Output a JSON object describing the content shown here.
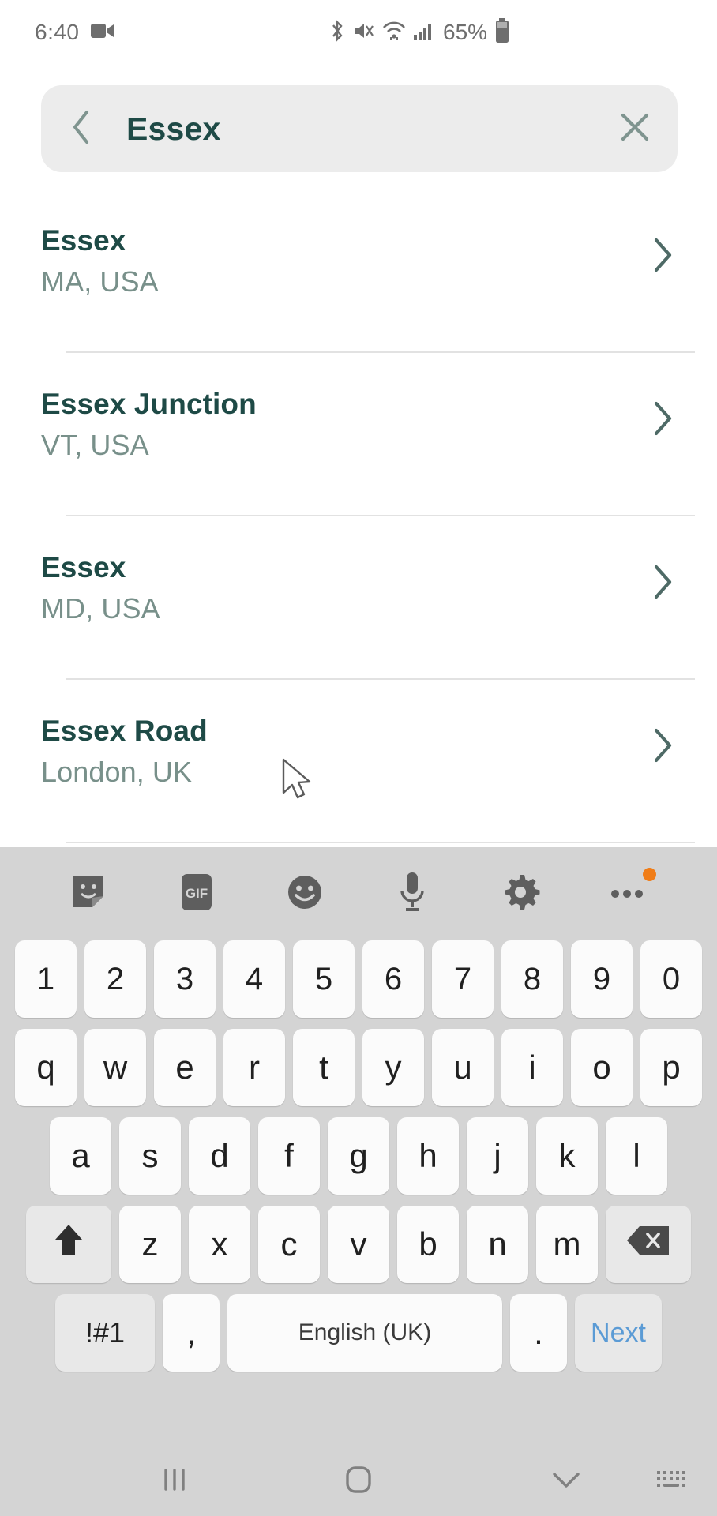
{
  "status_bar": {
    "time": "6:40",
    "battery_percent": "65%",
    "icons": [
      "video-recording-icon",
      "bluetooth-icon",
      "mute-vibrate-icon",
      "wifi-icon",
      "cellular-signal-icon",
      "battery-icon"
    ]
  },
  "search": {
    "query": "Essex",
    "back_icon": "chevron-left-icon",
    "clear_icon": "close-icon"
  },
  "results": [
    {
      "title": "Essex",
      "subtitle": "MA, USA"
    },
    {
      "title": "Essex Junction",
      "subtitle": "VT, USA"
    },
    {
      "title": "Essex",
      "subtitle": "MD, USA"
    },
    {
      "title": "Essex Road",
      "subtitle": "London, UK"
    }
  ],
  "keyboard": {
    "toolbar": [
      {
        "name": "sticker-icon"
      },
      {
        "name": "gif-icon",
        "label": "GIF"
      },
      {
        "name": "emoji-icon"
      },
      {
        "name": "microphone-icon"
      },
      {
        "name": "settings-gear-icon"
      },
      {
        "name": "more-options-icon",
        "badge": true
      }
    ],
    "row_numbers": [
      "1",
      "2",
      "3",
      "4",
      "5",
      "6",
      "7",
      "8",
      "9",
      "0"
    ],
    "row_qwerty": [
      "q",
      "w",
      "e",
      "r",
      "t",
      "y",
      "u",
      "i",
      "o",
      "p"
    ],
    "row_asdf": [
      "a",
      "s",
      "d",
      "f",
      "g",
      "h",
      "j",
      "k",
      "l"
    ],
    "row_zxcv": [
      "z",
      "x",
      "c",
      "v",
      "b",
      "n",
      "m"
    ],
    "shift_icon": "shift-arrow-icon",
    "backspace_icon": "backspace-icon",
    "symbols_label": "!#1",
    "comma_label": ",",
    "space_label": "English (UK)",
    "period_label": ".",
    "next_label": "Next"
  },
  "nav_bar": {
    "recents_icon": "recents-icon",
    "home_icon": "home-icon",
    "hide_keyboard_icon": "chevron-down-icon",
    "switch_keyboard_icon": "keyboard-switch-icon"
  },
  "colors": {
    "primary_text": "#1e4a46",
    "secondary_text": "#78908a",
    "search_bg": "#ececec",
    "keyboard_bg": "#d4d4d4",
    "key_bg": "#fbfbfb",
    "accent_blue": "#5b9bd5",
    "badge_orange": "#f07d18"
  }
}
